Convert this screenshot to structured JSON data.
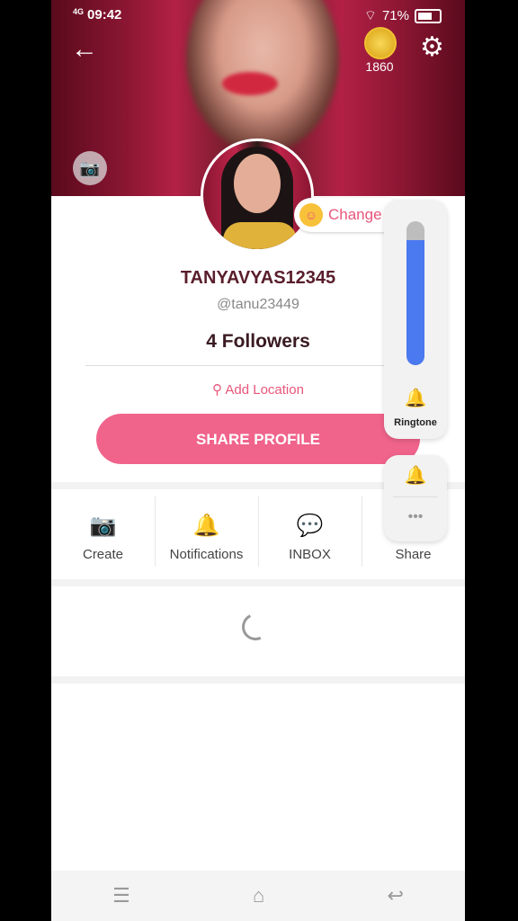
{
  "status_bar": {
    "network": "4G",
    "time": "09:42",
    "battery": "71%"
  },
  "header": {
    "coins": "1860"
  },
  "profile": {
    "change_label": "Change",
    "username": "TANYAVYAS12345",
    "handle": "@tanu23449",
    "followers": "4 Followers",
    "add_location": "Add Location",
    "share_button": "SHARE PROFILE"
  },
  "actions": [
    {
      "label": "Create",
      "icon": "camera-icon"
    },
    {
      "label": "Notifications",
      "icon": "bell-icon"
    },
    {
      "label": "INBOX",
      "icon": "chat-icon"
    },
    {
      "label": "Share",
      "icon": "share-icon"
    }
  ],
  "volume_panel": {
    "label": "Ringtone",
    "level": 0.87,
    "accent": "#4a79f0"
  },
  "colors": {
    "accent": "#f0638b",
    "text_pink": "#e8567a"
  }
}
